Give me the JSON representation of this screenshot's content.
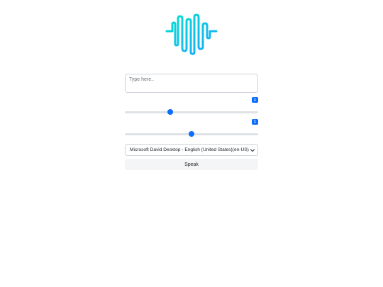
{
  "textarea": {
    "placeholder": "Type here.."
  },
  "rate": {
    "badge": "1",
    "value": 0.34
  },
  "pitch": {
    "badge": "1",
    "value": 0.5
  },
  "voice_select": {
    "selected": "Microsoft David Desktop - English (United States)(en-US)"
  },
  "speak_button": {
    "label": "Speak"
  },
  "colors": {
    "accent": "#0d6efd",
    "logo_gradient_start": "#00e0d0",
    "logo_gradient_end": "#1ea7ff"
  }
}
